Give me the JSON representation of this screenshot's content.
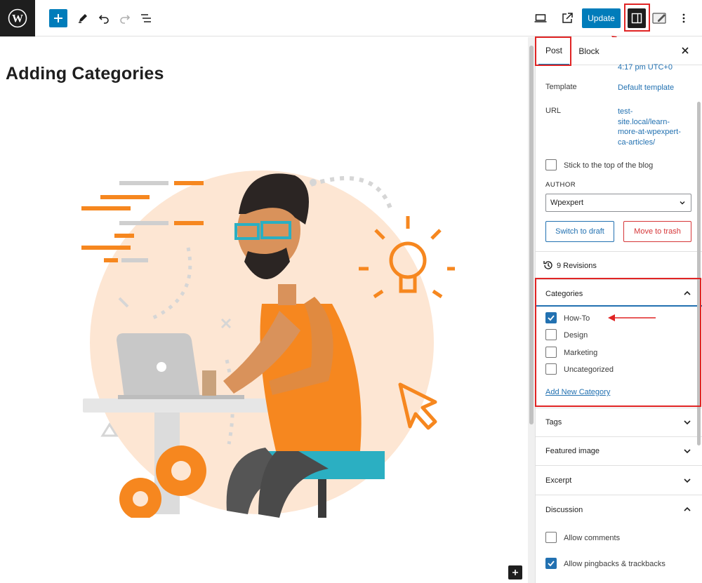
{
  "toolbar": {
    "logo": "wordpress-logo",
    "update_label": "Update"
  },
  "post": {
    "title": "Adding Categories"
  },
  "sidebar": {
    "tabs": [
      "Post",
      "Block"
    ],
    "publish_time": "4:17 pm UTC+0",
    "template_label": "Template",
    "template_value": "Default template",
    "url_label": "URL",
    "url_lines": [
      "test-",
      "site.local/learn-",
      "more-at-wpexpert-",
      "ca-articles/"
    ],
    "stick_label": "Stick to the top of the blog",
    "author_label": "AUTHOR",
    "author_value": "Wpexpert",
    "switch_draft": "Switch to draft",
    "move_trash": "Move to trash",
    "revisions": "9 Revisions",
    "categories_title": "Categories",
    "categories": [
      {
        "label": "How-To",
        "checked": true
      },
      {
        "label": "Design",
        "checked": false
      },
      {
        "label": "Marketing",
        "checked": false
      },
      {
        "label": "Uncategorized",
        "checked": false
      }
    ],
    "add_category": "Add New Category",
    "tags": "Tags",
    "featured_image": "Featured image",
    "excerpt": "Excerpt",
    "discussion": "Discussion",
    "allow_comments": "Allow comments",
    "allow_pingbacks": "Allow pingbacks & trackbacks"
  },
  "colors": {
    "accent": "#007cba",
    "highlight": "#e02424",
    "illustration_orange": "#f6871f"
  }
}
